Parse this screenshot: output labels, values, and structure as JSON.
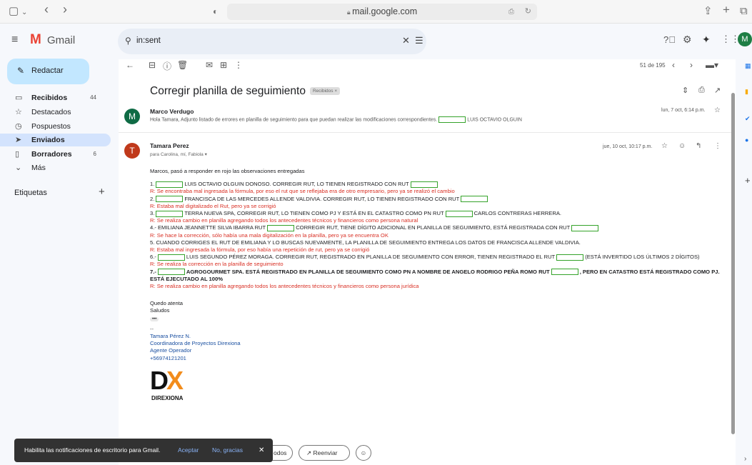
{
  "browser": {
    "url": "mail.google.com",
    "sidebar_icon": "sidebar-icon",
    "back": "‹",
    "forward": "›"
  },
  "gmail": {
    "brand": "Gmail",
    "search": {
      "value": "in:sent"
    },
    "compose_label": "Redactar",
    "nav": [
      {
        "icon": "inbox-icon",
        "label": "Recibidos",
        "count": "44",
        "bold": true
      },
      {
        "icon": "star-icon",
        "label": "Destacados",
        "count": "",
        "bold": false
      },
      {
        "icon": "clock-icon",
        "label": "Pospuestos",
        "count": "",
        "bold": false
      },
      {
        "icon": "send-icon",
        "label": "Enviados",
        "count": "",
        "bold": true
      },
      {
        "icon": "draft-icon",
        "label": "Borradores",
        "count": "6",
        "bold": true
      },
      {
        "icon": "chevron-down-icon",
        "label": "Más",
        "count": "",
        "bold": false
      }
    ],
    "labels_heading": "Etiquetas",
    "account_initial": "M"
  },
  "toolbar": {
    "pagination": "51 de 195"
  },
  "thread": {
    "subject": "Corregir planilla de seguimiento",
    "badge": "Recibidos ×",
    "collapsed": {
      "initial": "M",
      "sender": "Marco Verdugo",
      "snippet": "Hola Tamara, Adjunto listado de errores en planilla de seguimiento para que puedan realizar las modificaciones correspondientes.",
      "snippet_name": "LUIS OCTAVIO OLGUIN",
      "date": "lun, 7 oct, 6:14 p.m."
    },
    "message": {
      "initial": "T",
      "sender": "Tamara Perez",
      "to": "para Carolina, mí, Fabiola ▾",
      "date": "jue, 10 oct, 10:17 p.m.",
      "intro": "Marcos, pasó a responder en rojo las observaciones entregadas",
      "items": [
        {
          "pre": "1.",
          "text": "LUIS OCTAVIO OLGUIN DONOSO. CORREGIR RUT, LO TIENEN REGISTRADO CON RUT",
          "tail": "",
          "reply": "R: Se encontraba mal ingresada la fórmula, por eso el rut que se reflejaba era de otro empresario, pero ya se realizó el cambio"
        },
        {
          "pre": "2.",
          "text": "FRANCISCA DE LAS MERCEDES ALLENDE VALDIVIA. CORREGIR RUT, LO TIENEN REGISTRADO CON RUT",
          "tail": "",
          "reply": "R: Estaba mal digitalizado el Rut, pero ya se corrigió"
        },
        {
          "pre": "3.",
          "text": "TERRA NUEVA SPA, CORREGIR RUT, LO TIENEN COMO PJ Y ESTÁ EN EL CATASTRO COMO PN RUT",
          "tail": "CARLOS CONTRERAS HERRERA.",
          "reply": "R: Se realiza cambio en planilla agregando todos los antecedentes técnicos y financieros como persona natural"
        },
        {
          "pre": "4.- EMILIANA JEANNETTE SILVA IBARRA RUT",
          "text": "CORREGIR RUT, TIENE DÍGITO ADICIONAL EN PLANILLA DE SEGUIMIENTO, ESTÁ REGISTRADA CON RUT",
          "tail": "",
          "reply": "R: Se hace la corrección, sólo había una mala digitalización en la planilla, pero ya se encuentra OK"
        }
      ],
      "item5": "5. CUANDO CORRIGES EL RUT DE EMILIANA Y LO BUSCAS NUEVAMENTE, LA PLANILLA DE SEGUIMIENTO ENTREGA LOS DATOS DE FRANCISCA ALLENDE VALDIVIA.",
      "reply5": "R: Estaba mal ingresada la fórmula, por eso había una repetición de rut, pero ya se corrigió",
      "item6_pre": "6.-",
      "item6": "LUIS SEGUNDO PÉREZ MORAGA. CORREGIR RUT, REGISTRADO EN PLANILLA DE SEGUIMIENTO CON ERROR, TIENEN REGISTRADO EL RUT",
      "item6_tail": "(ESTÁ INVERTIDO LOS ÚLTIMOS 2 DÍGITOS)",
      "reply6": "R: Se realiza la corrección en la planilla de seguimiento",
      "item7_pre": "7.-",
      "item7": "AGROGOURMET SPA. ESTÁ REGISTRADO EN PLANILLA DE SEGUIMIENTO COMO PN A NOMBRE DE ANGELO RODRIGO PEÑA ROMO RUT",
      "item7_tail": ", PERO EN CATASTRO ESTÁ REGISTRADO COMO PJ. ESTÁ EJECUTADO AL 100%",
      "reply7": "R: Se realiza cambio en planilla agregando todos los antecedentes técnicos y financieros como persona jurídica",
      "closing1": "Quedo atenta",
      "closing2": "Saludos",
      "ellipsis": "•••",
      "dash": "--",
      "sig": [
        "Tamara Pérez N.",
        "Coordinadora de Proyectos Direxiona",
        "Agente Operador",
        "+56974121201"
      ],
      "logo_text": "DX",
      "logo_word": "DIREXIONA"
    }
  },
  "actions": {
    "reply_all": "odos",
    "forward": "Reenviar"
  },
  "toast": {
    "text": "Habilita las notificaciones de escritorio para Gmail.",
    "accept": "Aceptar",
    "decline": "No, gracias",
    "close": "✕"
  }
}
